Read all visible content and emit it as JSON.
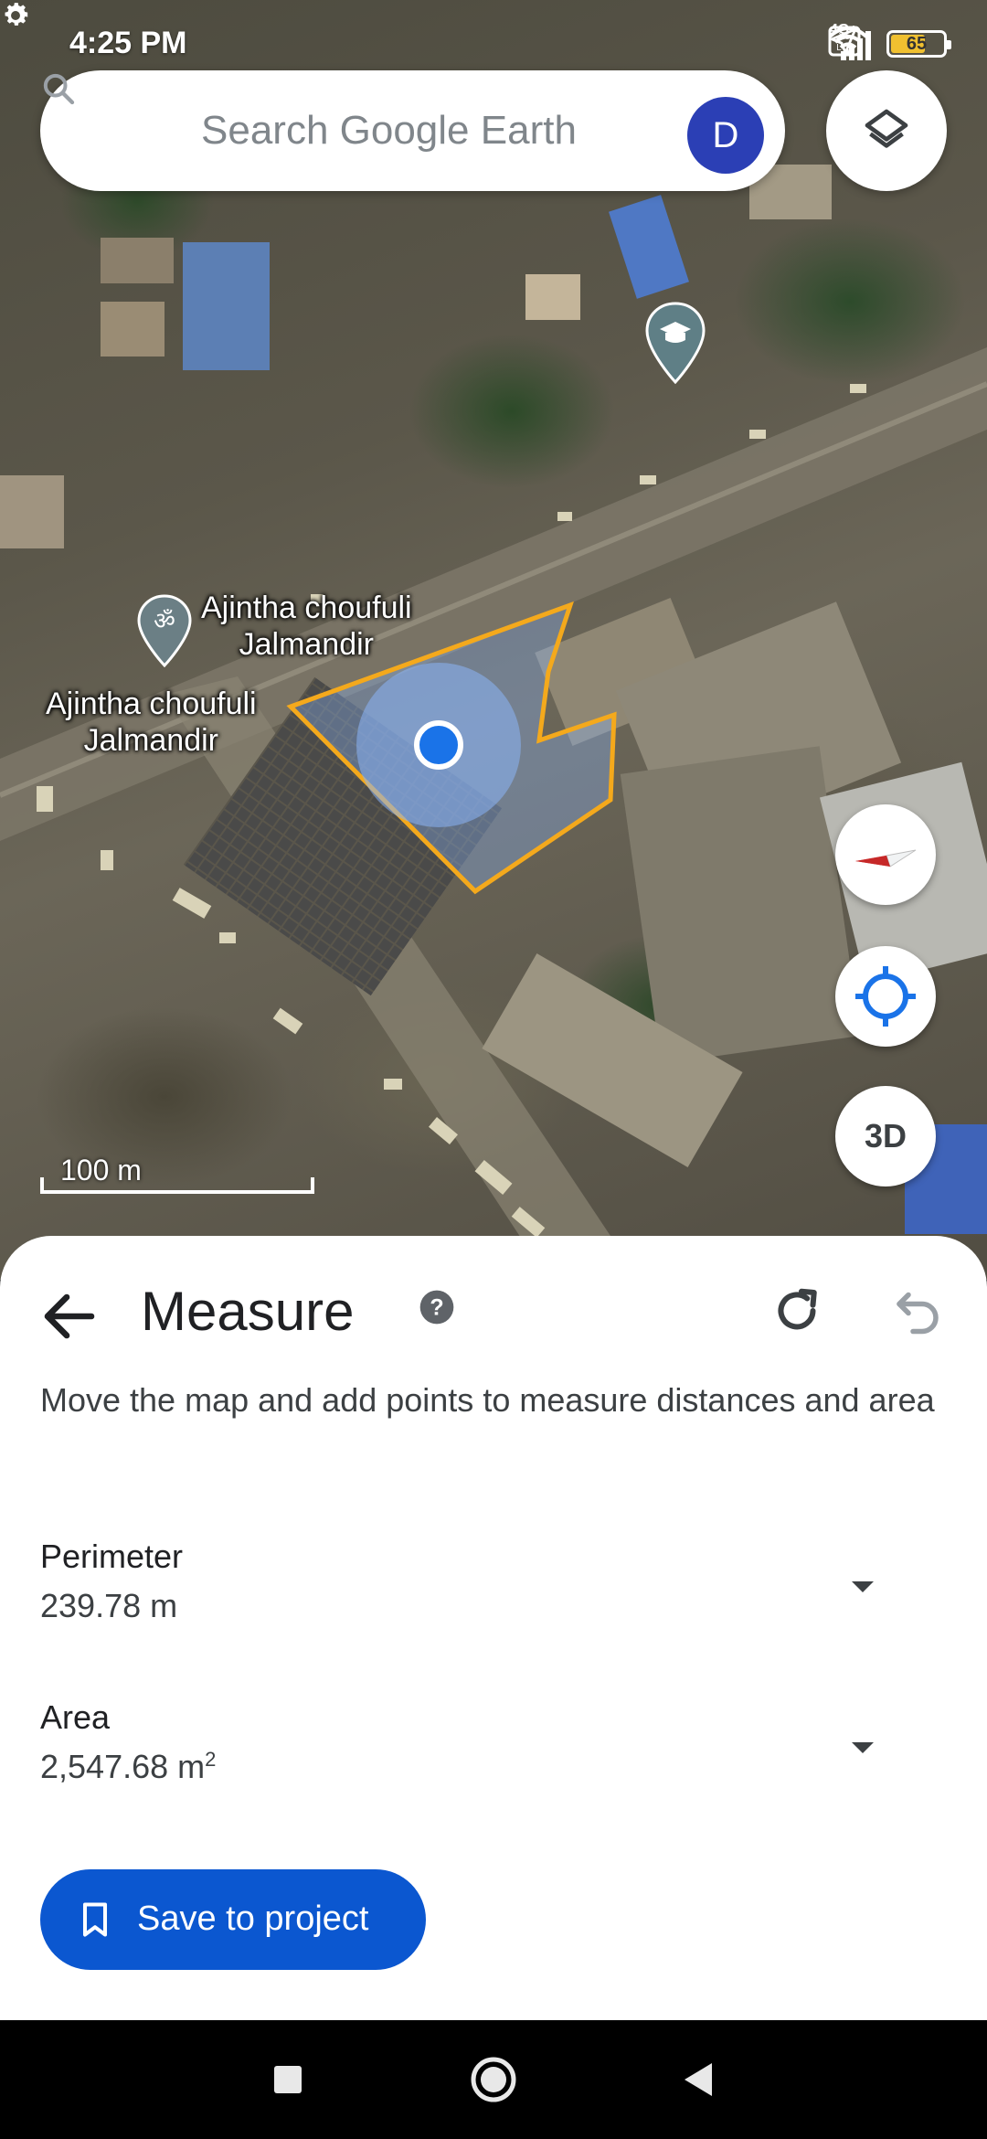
{
  "status_bar": {
    "time": "4:25 PM",
    "network": "4G+",
    "battery": "65",
    "icons": [
      "gear-icon",
      "wifi-icon",
      "location-arrow-icon",
      "volte-icon",
      "signal-icon",
      "battery-icon"
    ]
  },
  "search": {
    "placeholder": "Search Google Earth",
    "avatar_letter": "D"
  },
  "map": {
    "labels": [
      {
        "text_line1": "Ajintha choufuli",
        "text_line2": "Jalmandir"
      },
      {
        "text_line1": "Ajintha choufuli",
        "text_line2": "Jalmandir"
      }
    ],
    "scale_label": "100 m",
    "three_d_label": "3D",
    "polygon_color": "#f4a91c",
    "marker_color": "#1a73e8"
  },
  "measure": {
    "title": "Measure",
    "instructions": "Move the map and add points to measure distances and area",
    "perimeter_label": "Perimeter",
    "perimeter_value": "239.78 m",
    "area_label": "Area",
    "area_value": "2,547.68 m",
    "area_unit_sup": "2",
    "save_button": "Save to project"
  },
  "colors": {
    "accent": "#0b57d0",
    "avatar": "#2b3fb5"
  }
}
